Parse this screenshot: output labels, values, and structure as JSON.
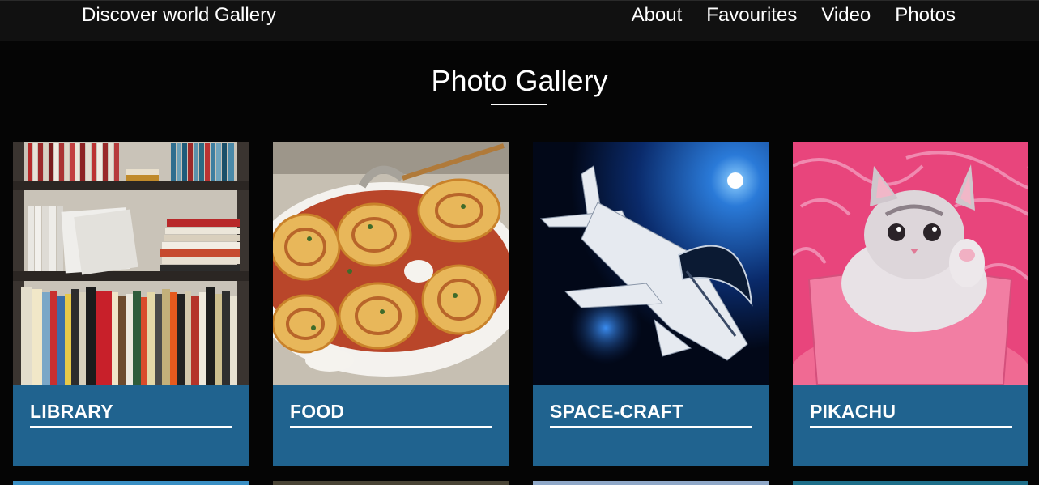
{
  "navbar": {
    "brand": "Discover world Gallery",
    "links": [
      "About",
      "Favourites",
      "Video",
      "Photos"
    ]
  },
  "gallery": {
    "heading": "Photo Gallery",
    "cards": [
      {
        "title": "LIBRARY",
        "image": "bookshelf-photo"
      },
      {
        "title": "FOOD",
        "image": "pasta-rolls-photo"
      },
      {
        "title": "SPACE-CRAFT",
        "image": "spacecraft-photo"
      },
      {
        "title": "PIKACHU",
        "image": "kitten-photo"
      }
    ]
  },
  "colors": {
    "background": "#050505",
    "navbar": "#111111",
    "caption": "#20638f",
    "text": "#ffffff"
  }
}
